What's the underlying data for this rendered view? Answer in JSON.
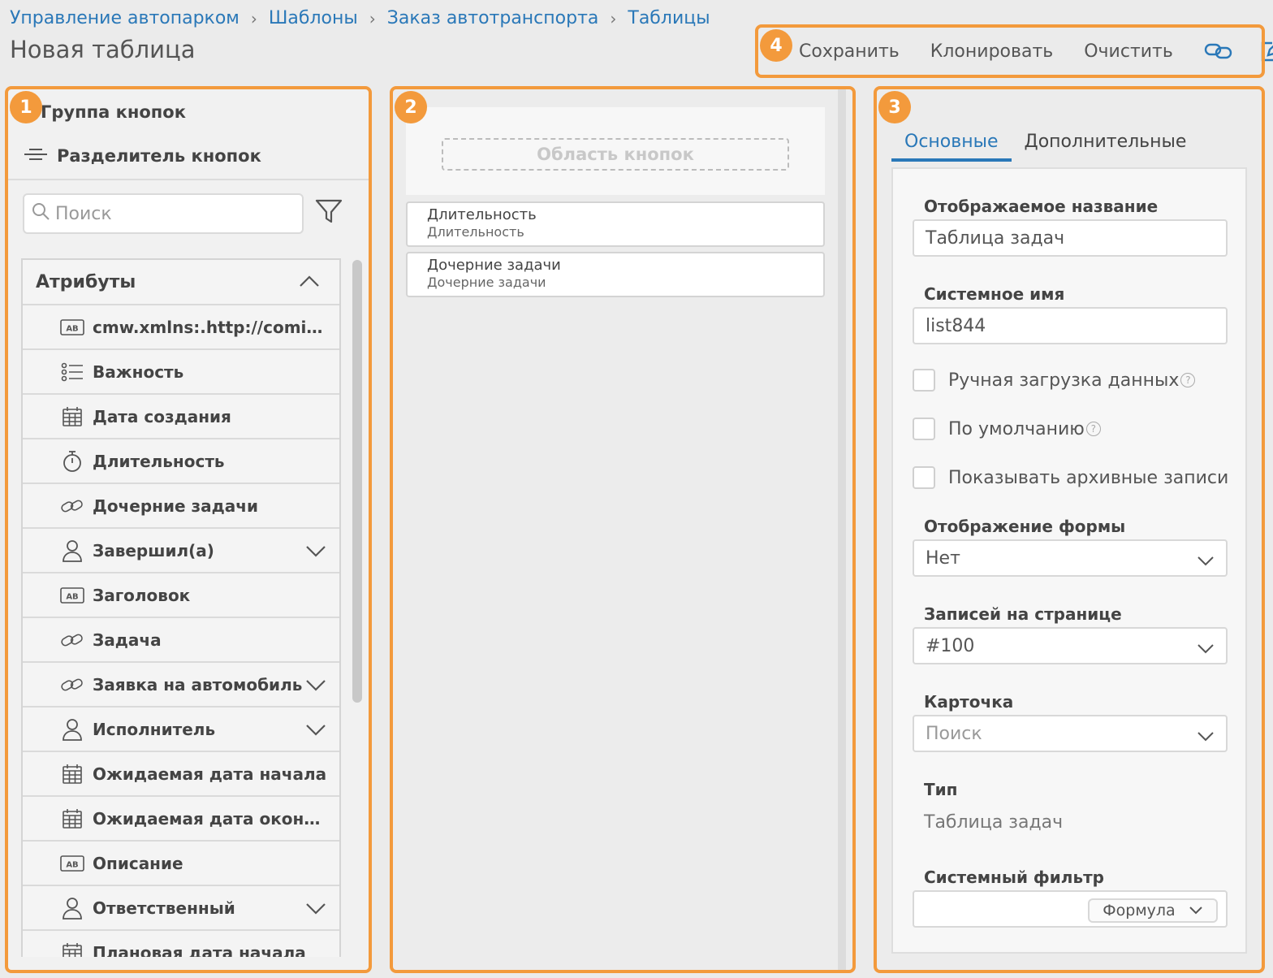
{
  "breadcrumb": [
    "Управление автопарком",
    "Шаблоны",
    "Заказ автотранспорта",
    "Таблицы"
  ],
  "page_title": "Новая таблица",
  "badges": [
    "1",
    "2",
    "3",
    "4"
  ],
  "toolbar": {
    "save": "Сохранить",
    "clone": "Клонировать",
    "clear": "Очистить",
    "icons": [
      "link-icon",
      "edit-icon"
    ]
  },
  "panel1": {
    "controls": [
      "Группа кнопок",
      "Разделитель кнопок"
    ],
    "search_placeholder": "Поиск",
    "attributes_title": "Атрибуты",
    "attributes": [
      {
        "label": "cmw.xmlns:.http://comind...",
        "icon": "text-icon",
        "expandable": false
      },
      {
        "label": "Важность",
        "icon": "list-icon",
        "expandable": false
      },
      {
        "label": "Дата создания",
        "icon": "calendar-icon",
        "expandable": false
      },
      {
        "label": "Длительность",
        "icon": "timer-icon",
        "expandable": false
      },
      {
        "label": "Дочерние задачи",
        "icon": "link-icon",
        "expandable": false
      },
      {
        "label": "Завершил(а)",
        "icon": "user-icon",
        "expandable": true
      },
      {
        "label": "Заголовок",
        "icon": "text-icon",
        "expandable": false
      },
      {
        "label": "Задача",
        "icon": "link-icon",
        "expandable": false
      },
      {
        "label": "Заявка на автомобиль",
        "icon": "link-icon",
        "expandable": true
      },
      {
        "label": "Исполнитель",
        "icon": "user-icon",
        "expandable": true
      },
      {
        "label": "Ожидаемая дата начала",
        "icon": "calendar-icon",
        "expandable": false
      },
      {
        "label": "Ожидаемая дата оконча...",
        "icon": "calendar-icon",
        "expandable": false
      },
      {
        "label": "Описание",
        "icon": "text-icon",
        "expandable": false
      },
      {
        "label": "Ответственный",
        "icon": "user-icon",
        "expandable": true
      },
      {
        "label": "Плановая дата начала",
        "icon": "calendar-icon",
        "expandable": false
      }
    ]
  },
  "panel2": {
    "button_area": "Область кнопок",
    "columns": [
      {
        "title": "Длительность",
        "subtitle": "Длительность"
      },
      {
        "title": "Дочерние задачи",
        "subtitle": "Дочерние задачи"
      }
    ]
  },
  "panel3": {
    "tabs": [
      "Основные",
      "Дополнительные"
    ],
    "display_name_label": "Отображаемое название",
    "display_name_value": "Таблица задач",
    "system_name_label": "Системное имя",
    "system_name_value": "list844",
    "checkboxes": [
      "Ручная загрузка данных",
      "По умолчанию",
      "Показывать архивные записи"
    ],
    "form_display_label": "Отображение формы",
    "form_display_value": "Нет",
    "per_page_label": "Записей на странице",
    "per_page_value": "#100",
    "card_label": "Карточка",
    "card_placeholder": "Поиск",
    "type_label": "Тип",
    "type_value": "Таблица задач",
    "system_filter_label": "Системный фильтр",
    "formula_label": "Формула"
  },
  "colors": {
    "accent": "#2a78b8",
    "marker": "#f39a3c"
  }
}
